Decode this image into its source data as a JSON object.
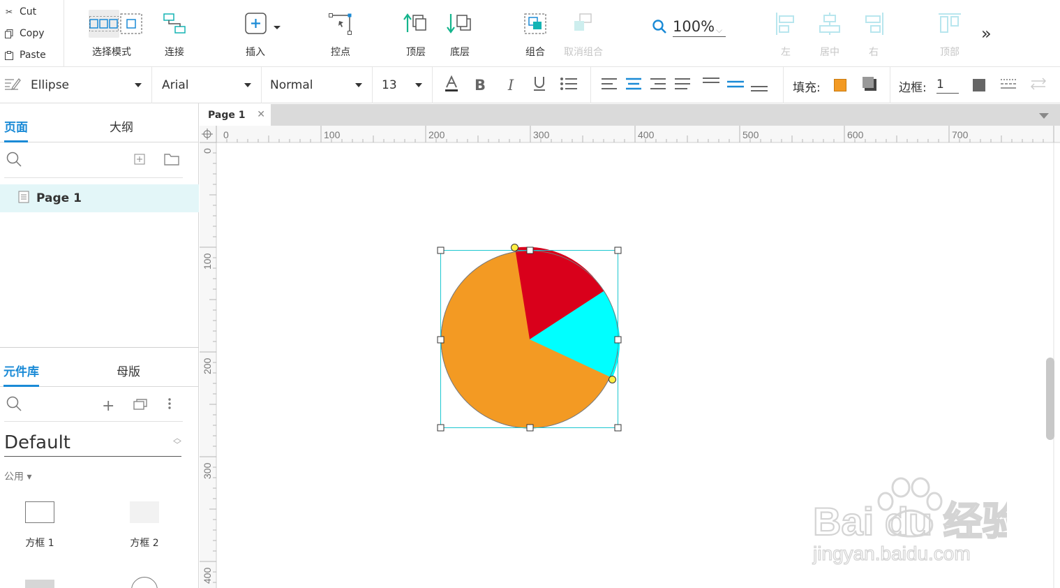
{
  "clipboard": {
    "cut": "Cut",
    "copy": "Copy",
    "paste": "Paste"
  },
  "toolbar": {
    "select_mode": "选择模式",
    "connect": "连接",
    "insert": "插入",
    "point": "控点",
    "top": "顶层",
    "bottom": "底层",
    "group": "组合",
    "ungroup": "取消组合",
    "zoom": "100%",
    "align_left": "左",
    "align_center": "居中",
    "align_right": "右",
    "align_top": "顶部"
  },
  "format": {
    "shape": "Ellipse",
    "font": "Arial",
    "weight": "Normal",
    "size": "13",
    "fill_label": "填充:",
    "fill_color": "#f39a23",
    "border_label": "边框:",
    "border_width": "1"
  },
  "pages_panel": {
    "tab_pages": "页面",
    "tab_outline": "大纲",
    "pages": [
      "Page 1"
    ]
  },
  "library_panel": {
    "tab_library": "元件库",
    "tab_masters": "母版",
    "library": "Default",
    "category": "公用 ▾",
    "widgets": [
      "方框 1",
      "方框 2"
    ]
  },
  "document": {
    "tab": "Page 1",
    "ruler_h": [
      "0",
      "100",
      "200",
      "300",
      "400",
      "500",
      "600",
      "700"
    ],
    "ruler_v": [
      "0",
      "100",
      "200",
      "300",
      "400"
    ]
  },
  "shape": {
    "slices": [
      {
        "name": "red",
        "color": "#d9001b"
      },
      {
        "name": "cyan",
        "color": "#00ffff"
      },
      {
        "name": "orange",
        "color": "#f39a23"
      }
    ],
    "selection_color": "#1cc7d0"
  },
  "watermark": {
    "brand": "Bai du 经验",
    "url": "jingyan.baidu.com"
  }
}
